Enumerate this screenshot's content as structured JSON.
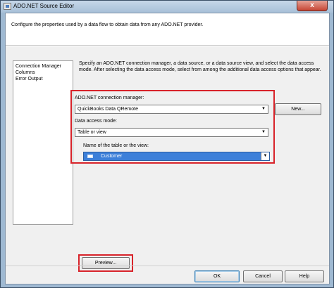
{
  "window": {
    "title": "ADO.NET Source Editor",
    "close_glyph": "x"
  },
  "header": {
    "description": "Configure the properties used by a data flow to obtain data from any ADO.NET provider."
  },
  "nav": {
    "items": [
      "Connection Manager",
      "Columns",
      "Error Output"
    ]
  },
  "main": {
    "intro": "Specify an ADO.NET connection manager, a data source, or a data source view, and select the data access mode. After selecting the data access mode, select from among the additional data access options that appear.",
    "connection_manager_label": "ADO.NET connection manager:",
    "connection_manager_value": "QuickBooks Data QRemote",
    "new_button_label": "New...",
    "access_mode_label": "Data access mode:",
    "access_mode_value": "Table or view",
    "table_label": "Name of the table or the view:",
    "table_value": "Customer",
    "preview_button_label": "Preview...",
    "dropdown_glyph": "▼"
  },
  "footer": {
    "ok_label": "OK",
    "cancel_label": "Cancel",
    "help_label": "Help"
  },
  "colors": {
    "highlight": "#d8232a",
    "selection": "#3c7fd9"
  }
}
